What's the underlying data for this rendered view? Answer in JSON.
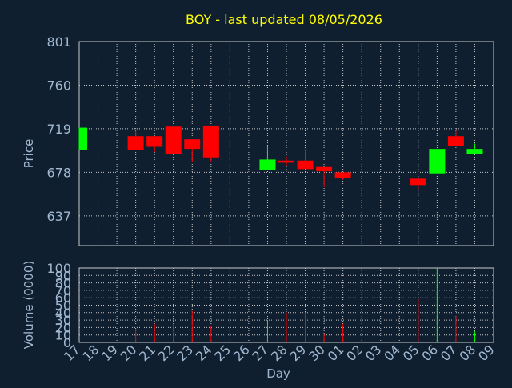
{
  "title": "BOY - last updated 08/05/2026",
  "colors": {
    "background": "#0f1f30",
    "title": "#ffff00",
    "label": "#a0b8d0",
    "grid": "#c8c8c8",
    "frame": "#c8c8c8",
    "up": "#00ff00",
    "down": "#ff0000"
  },
  "chart_data": [
    {
      "type": "candlestick",
      "ylabel": "Price",
      "ylim": [
        609,
        801
      ],
      "yticks": [
        "801",
        "760",
        "719",
        "678",
        "637"
      ],
      "grid": true,
      "categories": [
        "17",
        "18",
        "19",
        "20",
        "21",
        "22",
        "23",
        "24",
        "25",
        "26",
        "27",
        "28",
        "29",
        "30",
        "01",
        "02",
        "03",
        "04",
        "05",
        "06",
        "07",
        "08",
        "09"
      ],
      "candles": [
        {
          "x": "17",
          "open": 699,
          "close": 720,
          "high": 720,
          "low": 699
        },
        {
          "x": "20",
          "open": 712,
          "close": 699,
          "high": 717,
          "low": 699
        },
        {
          "x": "21",
          "open": 712,
          "close": 702,
          "high": 712,
          "low": 697
        },
        {
          "x": "22",
          "open": 721,
          "close": 695,
          "high": 721,
          "low": 695
        },
        {
          "x": "23",
          "open": 709,
          "close": 700,
          "high": 709,
          "low": 688
        },
        {
          "x": "24",
          "open": 722,
          "close": 692,
          "high": 722,
          "low": 688
        },
        {
          "x": "27",
          "open": 680,
          "close": 690,
          "high": 703,
          "low": 680
        },
        {
          "x": "28",
          "open": 689,
          "close": 687,
          "high": 693,
          "low": 684
        },
        {
          "x": "29",
          "open": 689,
          "close": 681,
          "high": 700,
          "low": 681
        },
        {
          "x": "30",
          "open": 683,
          "close": 679,
          "high": 682,
          "low": 664
        },
        {
          "x": "01",
          "open": 678,
          "close": 673,
          "high": 678,
          "low": 671
        },
        {
          "x": "05",
          "open": 672,
          "close": 666,
          "high": 672,
          "low": 662
        },
        {
          "x": "06",
          "open": 677,
          "close": 700,
          "high": 700,
          "low": 677
        },
        {
          "x": "07",
          "open": 712,
          "close": 703,
          "high": 717,
          "low": 703
        },
        {
          "x": "08",
          "open": 695,
          "close": 700,
          "high": 705,
          "low": 695
        }
      ]
    },
    {
      "type": "bar",
      "ylabel": "Volume (0000)",
      "xlabel": "Day",
      "ylim": [
        0,
        100
      ],
      "yticks": [
        "100",
        "90",
        "80",
        "70",
        "60",
        "50",
        "40",
        "30",
        "20",
        "10",
        "0"
      ],
      "grid": true,
      "categories": [
        "17",
        "18",
        "19",
        "20",
        "21",
        "22",
        "23",
        "24",
        "25",
        "26",
        "27",
        "28",
        "29",
        "30",
        "01",
        "02",
        "03",
        "04",
        "05",
        "06",
        "07",
        "08",
        "09"
      ],
      "bars": [
        {
          "x": "20",
          "value": 18,
          "direction": "down"
        },
        {
          "x": "21",
          "value": 25,
          "direction": "down"
        },
        {
          "x": "22",
          "value": 25,
          "direction": "down"
        },
        {
          "x": "23",
          "value": 42,
          "direction": "down"
        },
        {
          "x": "24",
          "value": 22,
          "direction": "down"
        },
        {
          "x": "27",
          "value": 30,
          "direction": "up"
        },
        {
          "x": "28",
          "value": 40,
          "direction": "down"
        },
        {
          "x": "29",
          "value": 40,
          "direction": "down"
        },
        {
          "x": "30",
          "value": 12,
          "direction": "down"
        },
        {
          "x": "01",
          "value": 25,
          "direction": "down"
        },
        {
          "x": "05",
          "value": 58,
          "direction": "down"
        },
        {
          "x": "06",
          "value": 100,
          "direction": "up"
        },
        {
          "x": "07",
          "value": 35,
          "direction": "down"
        },
        {
          "x": "08",
          "value": 15,
          "direction": "up"
        }
      ]
    }
  ]
}
